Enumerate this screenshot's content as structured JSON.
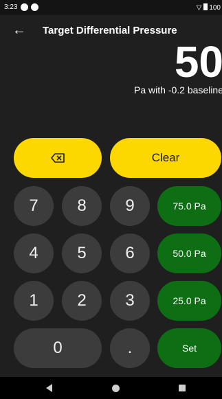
{
  "status_bar": {
    "time": "3:23",
    "battery": "100",
    "icons": [
      "notification-dot-icon",
      "notification-dot-icon",
      "wifi-icon",
      "battery-icon"
    ]
  },
  "header": {
    "title": "Target Differential Pressure",
    "back_icon": "arrow-left-icon"
  },
  "display": {
    "value": "50",
    "subtitle": "Pa with -0.2 baseline"
  },
  "keypad": {
    "backspace_icon": "backspace-icon",
    "clear": "Clear",
    "digits": [
      "7",
      "8",
      "9",
      "4",
      "5",
      "6",
      "1",
      "2",
      "3",
      "0",
      "."
    ],
    "presets": [
      "75.0 Pa",
      "50.0 Pa",
      "25.0 Pa"
    ],
    "set": "Set"
  },
  "colors": {
    "background": "#1f1f1f",
    "accent_yellow": "#fcd700",
    "key_gray": "#3c3c3c",
    "preset_green": "#0d6e14"
  },
  "nav": {
    "icons": [
      "nav-back-icon",
      "nav-home-icon",
      "nav-recents-icon"
    ]
  }
}
